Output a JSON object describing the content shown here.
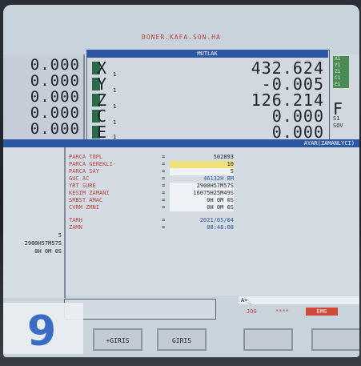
{
  "header": {
    "title": "DONER.KAFA.SON.HA"
  },
  "coordinates": {
    "left_values": [
      "0.000",
      "0.000",
      "0.000",
      "0.000",
      "0.000"
    ],
    "panel_title": "MUTLAK",
    "axes": [
      {
        "name": "X",
        "sub": "1",
        "value": "432.624"
      },
      {
        "name": "Y",
        "sub": "1",
        "value": "-0.005"
      },
      {
        "name": "Z",
        "sub": "1",
        "value": "126.214"
      },
      {
        "name": "C",
        "sub": "1",
        "value": "0.000"
      },
      {
        "name": "E",
        "sub": "1",
        "value": "0.000"
      }
    ],
    "right_axes": [
      "X1",
      "Y1",
      "Z1",
      "C1",
      "E1"
    ],
    "feed_label": "F",
    "spindle_labels": [
      "S1",
      "SOV"
    ]
  },
  "section": {
    "title": "AYAR(ZAMANLYCI)"
  },
  "left_info": [
    "5",
    "2900H57M57S",
    "0H 0M 0S"
  ],
  "parameters": [
    {
      "label": "PARCA TOPL",
      "eq": "=",
      "value": "502893",
      "style": "plain"
    },
    {
      "label": "PARCA GEREKLI-",
      "eq": "=",
      "value": "10",
      "style": "hl"
    },
    {
      "label": "PARCA SAY",
      "eq": "=",
      "value": "5",
      "style": "box"
    },
    {
      "label": "GUC AC",
      "eq": "=",
      "value": "46132H 8M",
      "style": "blue"
    },
    {
      "label": "YRT SURE",
      "eq": "=",
      "value": "2900H57M57S",
      "style": "box"
    },
    {
      "label": "KESIM ZAMANI",
      "eq": "=",
      "value": "16075H25M49S",
      "style": "box"
    },
    {
      "label": "SRBST AMAC",
      "eq": "=",
      "value": "0H 0M 0S",
      "style": "box"
    },
    {
      "label": "CVRM ZMNI",
      "eq": "=",
      "value": "0H 0M 0S",
      "style": "box"
    },
    {
      "label": "TARH",
      "eq": "=",
      "value": "2021/05/04",
      "style": "date"
    },
    {
      "label": "ZAMN",
      "eq": "=",
      "value": "08:48:08",
      "style": "date"
    }
  ],
  "input_prompt": "A>_",
  "status": {
    "mode": "JOG",
    "dots": "****",
    "alarm": "EMG"
  },
  "softkeys": [
    "+GIRIS",
    "GIRIS",
    "",
    ""
  ],
  "badge": {
    "number": "9"
  },
  "colors": {
    "header_blue": "#2d57a3",
    "label_red": "#b8443c",
    "highlight_yellow": "#efe27a",
    "axis_green": "#2c6b4a",
    "badge_blue": "#3a6cc4",
    "emg_red": "#d04a3c"
  }
}
